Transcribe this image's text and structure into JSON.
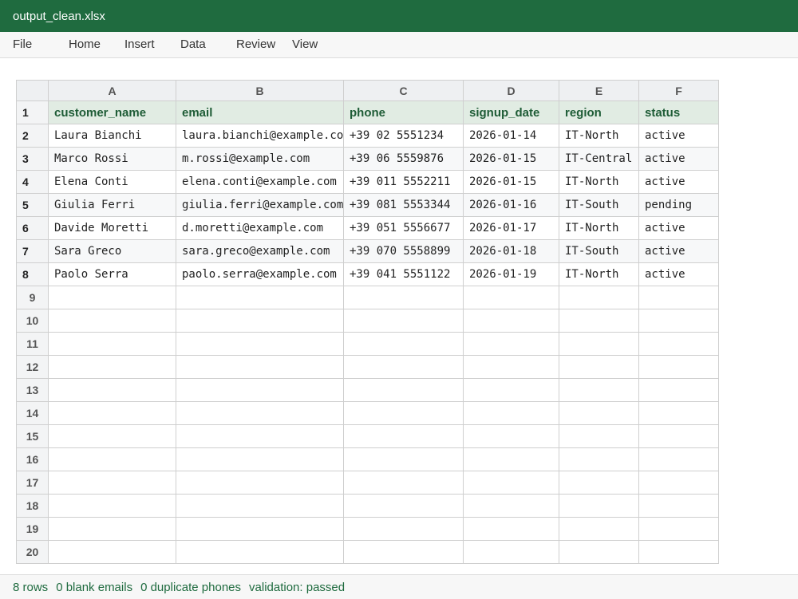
{
  "window": {
    "title": "output_clean.xlsx"
  },
  "menu": [
    "File",
    "Home",
    "Insert",
    "Data",
    "Review",
    "View"
  ],
  "sheet": {
    "columns": [
      "A",
      "B",
      "C",
      "D",
      "E",
      "F"
    ],
    "header": [
      "customer_name",
      "email",
      "phone",
      "signup_date",
      "region",
      "status"
    ],
    "rows": [
      [
        "Laura Bianchi",
        "laura.bianchi@example.com",
        "+39 02 5551234",
        "2026-01-14",
        "IT-North",
        "active"
      ],
      [
        "Marco Rossi",
        "m.rossi@example.com",
        "+39 06 5559876",
        "2026-01-15",
        "IT-Central",
        "active"
      ],
      [
        "Elena Conti",
        "elena.conti@example.com",
        "+39 011 5552211",
        "2026-01-15",
        "IT-North",
        "active"
      ],
      [
        "Giulia Ferri",
        "giulia.ferri@example.com",
        "+39 081 5553344",
        "2026-01-16",
        "IT-South",
        "pending"
      ],
      [
        "Davide Moretti",
        "d.moretti@example.com",
        "+39 051 5556677",
        "2026-01-17",
        "IT-North",
        "active"
      ],
      [
        "Sara Greco",
        "sara.greco@example.com",
        "+39 070 5558899",
        "2026-01-18",
        "IT-South",
        "active"
      ],
      [
        "Paolo Serra",
        "paolo.serra@example.com",
        "+39 041 5551122",
        "2026-01-19",
        "IT-North",
        "active"
      ]
    ],
    "row_numbers": [
      "1",
      "2",
      "3",
      "4",
      "5",
      "6",
      "7",
      "8",
      "9",
      "10",
      "11",
      "12",
      "13",
      "14",
      "15",
      "16",
      "17",
      "18",
      "19",
      "20"
    ]
  },
  "status": {
    "rows": "8 rows",
    "blank_emails": "0 blank emails",
    "duplicate_phones": "0 duplicate phones",
    "validation": "validation: passed"
  },
  "colors": {
    "title_bar": "#1f6b3f",
    "header_fill": "#e1ece3",
    "header_text": "#1e5c36",
    "status_text": "#1f6b3f"
  }
}
